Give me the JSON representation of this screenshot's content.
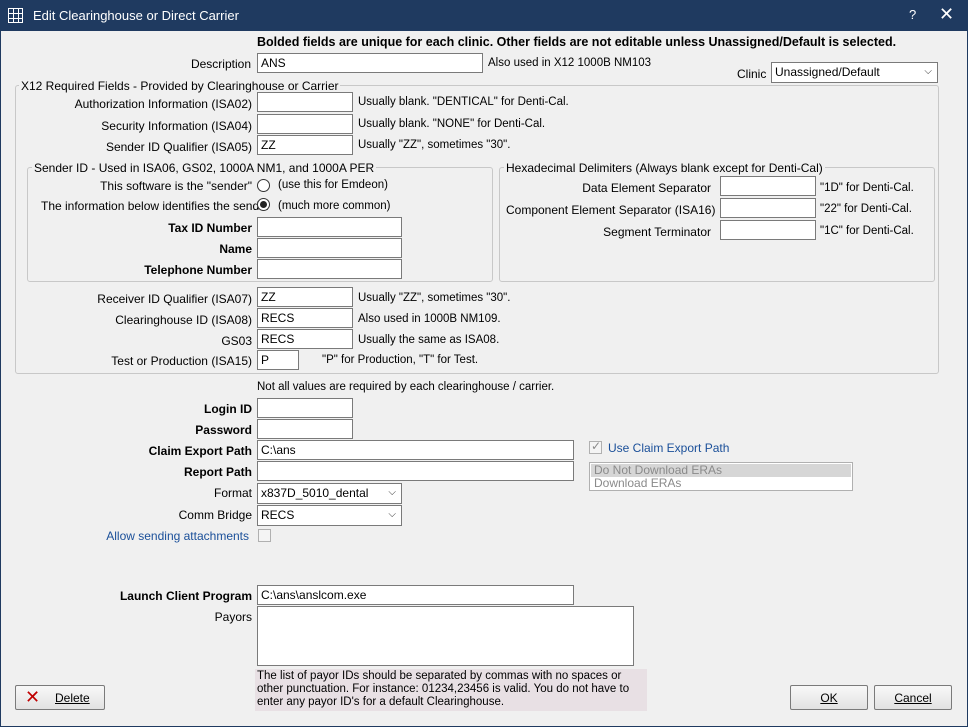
{
  "window": {
    "title": "Edit Clearinghouse or Direct Carrier",
    "help": "?",
    "close": "✕"
  },
  "top_notice": "Bolded fields are unique for each clinic.  Other fields are not editable unless Unassigned/Default is selected.",
  "description": {
    "label": "Description",
    "value": "ANS",
    "hint": "Also used in X12 1000B NM103"
  },
  "clinic": {
    "label": "Clinic",
    "value": "Unassigned/Default"
  },
  "x12": {
    "title": "X12 Required Fields - Provided by Clearinghouse or Carrier",
    "isa02": {
      "label": "Authorization Information (ISA02)",
      "value": "",
      "hint": "Usually blank. \"DENTICAL\" for Denti-Cal."
    },
    "isa04": {
      "label": "Security Information (ISA04)",
      "value": "",
      "hint": "Usually blank. \"NONE\" for Denti-Cal."
    },
    "isa05": {
      "label": "Sender ID Qualifier (ISA05)",
      "value": "ZZ",
      "hint": "Usually \"ZZ\", sometimes \"30\"."
    },
    "sender": {
      "title": "Sender ID - Used in ISA06, GS02, 1000A NM1, and 1000A PER",
      "opt_software_label": "This software is the \"sender\"",
      "opt_software_hint": "(use this for Emdeon)",
      "opt_info_label": "The information below identifies the sender",
      "opt_info_hint": "(much more common)",
      "selected": "info",
      "tax_id_label": "Tax ID Number",
      "tax_id_value": "",
      "name_label": "Name",
      "name_value": "",
      "phone_label": "Telephone Number",
      "phone_value": ""
    },
    "hex": {
      "title": "Hexadecimal Delimiters (Always blank except for Denti-Cal)",
      "data_sep_label": "Data Element Separator",
      "data_sep_value": "",
      "data_sep_hint": "\"1D\" for Denti-Cal.",
      "comp_sep_label": "Component Element Separator (ISA16)",
      "comp_sep_value": "",
      "comp_sep_hint": "\"22\" for Denti-Cal.",
      "seg_term_label": "Segment Terminator",
      "seg_term_value": "",
      "seg_term_hint": "\"1C\" for Denti-Cal."
    },
    "isa07": {
      "label": "Receiver ID Qualifier (ISA07)",
      "value": "ZZ",
      "hint": "Usually \"ZZ\", sometimes \"30\"."
    },
    "isa08": {
      "label": "Clearinghouse ID (ISA08)",
      "value": "RECS",
      "hint": "Also used in 1000B NM109."
    },
    "gs03": {
      "label": "GS03",
      "value": "RECS",
      "hint": "Usually the same as ISA08."
    },
    "isa15": {
      "label": "Test or Production (ISA15)",
      "value": "P",
      "hint": "\"P\" for Production,  \"T\" for Test."
    }
  },
  "not_all_required": "Not all values are required by each clearinghouse / carrier.",
  "login_id": {
    "label": "Login ID",
    "value": ""
  },
  "password": {
    "label": "Password",
    "value": ""
  },
  "claim_export_path": {
    "label": "Claim Export Path",
    "value": "C:\\ans"
  },
  "report_path": {
    "label": "Report Path",
    "value": ""
  },
  "format": {
    "label": "Format",
    "value": "x837D_5010_dental"
  },
  "comm_bridge": {
    "label": "Comm Bridge",
    "value": "RECS"
  },
  "allow_attachments": {
    "label": "Allow sending attachments",
    "checked": false
  },
  "use_claim_export_path": {
    "label": "Use Claim Export Path",
    "checked": true
  },
  "era_options": [
    "Do Not Download ERAs",
    "Download ERAs"
  ],
  "era_selected": "Do Not Download ERAs",
  "launch_client": {
    "label": "Launch Client Program",
    "value": "C:\\ans\\anslcom.exe"
  },
  "payors": {
    "label": "Payors",
    "value": "",
    "note": "The list of payor IDs should be separated by commas with no spaces or other punctuation.  For instance: 01234,23456 is valid.  You do not have to enter any payor ID's for a default Clearinghouse."
  },
  "buttons": {
    "delete": "Delete",
    "ok": "OK",
    "cancel": "Cancel"
  },
  "colors": {
    "titlebar": "#1f3a60",
    "link_blue": "#1a4f99",
    "delete_red": "#c00000"
  }
}
